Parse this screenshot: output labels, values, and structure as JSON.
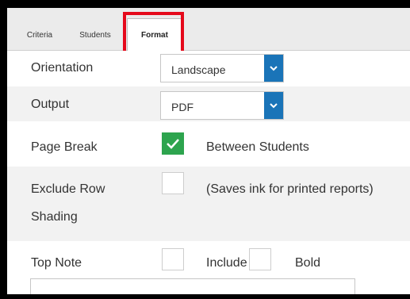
{
  "tabs": [
    {
      "label": "Criteria"
    },
    {
      "label": "Students"
    },
    {
      "label": "Format"
    }
  ],
  "form": {
    "orientation": {
      "label": "Orientation",
      "value": "Landscape"
    },
    "output": {
      "label": "Output",
      "value": "PDF"
    },
    "page_break": {
      "label": "Page Break",
      "checked": true,
      "option_label": "Between Students"
    },
    "exclude_row_shading": {
      "label_line1": "Exclude Row",
      "label_line2": "Shading",
      "checked": false,
      "option_label": "(Saves ink for printed reports)"
    },
    "top_note": {
      "label": "Top Note",
      "include_label": "Include",
      "include_checked": false,
      "bold_label": "Bold",
      "bold_checked": false,
      "text_value": ""
    }
  },
  "colors": {
    "accent": "#1a74b8",
    "check": "#2da44e",
    "highlight": "#e5091b"
  }
}
